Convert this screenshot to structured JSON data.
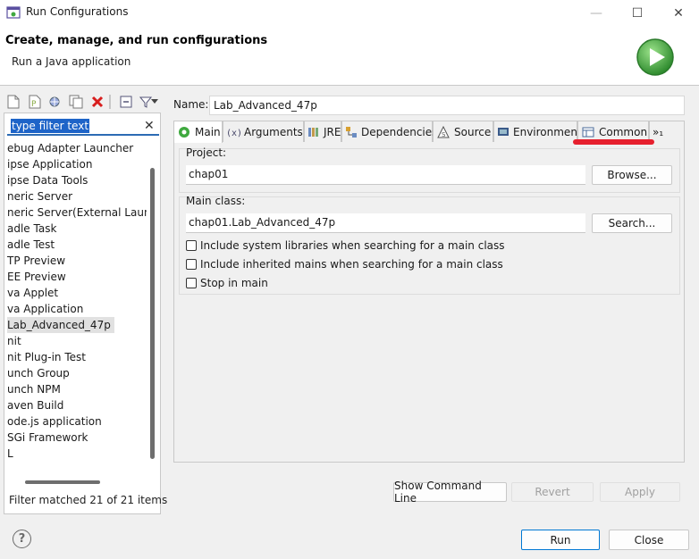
{
  "window": {
    "title": "Run Configurations",
    "min_glyph": "—",
    "max_glyph": "☐",
    "close_glyph": "✕"
  },
  "header": {
    "title": "Create, manage, and run configurations",
    "subtitle": "Run a Java application",
    "icon": "run-play-icon",
    "accent": "#3fa93f"
  },
  "left": {
    "toolbar_icons": [
      "new-config-icon",
      "new-prototype-icon",
      "export-icon",
      "duplicate-icon",
      "delete-icon",
      "collapse-all-icon",
      "filter-icon",
      "dropdown-arrow-icon"
    ],
    "filter_placeholder": "type filter text",
    "filter_clear_glyph": "✕",
    "items": [
      {
        "label": "ebug Adapter Launcher",
        "selected": false
      },
      {
        "label": "ipse Application",
        "selected": false
      },
      {
        "label": "ipse Data Tools",
        "selected": false
      },
      {
        "label": "neric Server",
        "selected": false
      },
      {
        "label": "neric Server(External Launch",
        "selected": false
      },
      {
        "label": "adle Task",
        "selected": false
      },
      {
        "label": "adle Test",
        "selected": false
      },
      {
        "label": "TP Preview",
        "selected": false
      },
      {
        "label": "EE Preview",
        "selected": false
      },
      {
        "label": "va Applet",
        "selected": false
      },
      {
        "label": "va Application",
        "selected": false
      },
      {
        "label": "Lab_Advanced_47p",
        "selected": true
      },
      {
        "label": "nit",
        "selected": false
      },
      {
        "label": "nit Plug-in Test",
        "selected": false
      },
      {
        "label": "unch Group",
        "selected": false
      },
      {
        "label": "unch NPM",
        "selected": false
      },
      {
        "label": "aven Build",
        "selected": false
      },
      {
        "label": "ode.js application",
        "selected": false
      },
      {
        "label": "SGi Framework",
        "selected": false
      },
      {
        "label": "L",
        "selected": false
      }
    ],
    "filter_status": "Filter matched 21 of 21 items"
  },
  "right": {
    "name_label": "Name:",
    "name_value": "Lab_Advanced_47p",
    "tabs": [
      {
        "label": "Main",
        "icon": "main-tab-icon",
        "active": true
      },
      {
        "label": "Arguments",
        "icon": "arguments-icon",
        "active": false
      },
      {
        "label": "JRE",
        "icon": "jre-icon",
        "active": false
      },
      {
        "label": "Dependencies",
        "icon": "dependencies-icon",
        "active": false
      },
      {
        "label": "Source",
        "icon": "source-icon",
        "active": false
      },
      {
        "label": "Environment",
        "icon": "environment-icon",
        "active": false
      },
      {
        "label": "Common",
        "icon": "common-icon",
        "active": false
      }
    ],
    "tab_overflow_label": "»₁",
    "project_label": "Project:",
    "project_value": "chap01",
    "browse_label": "Browse...",
    "main_class_label": "Main class:",
    "main_class_value": "chap01.Lab_Advanced_47p",
    "search_label": "Search...",
    "checks": [
      {
        "label": "Include system libraries when searching for a main class",
        "checked": false
      },
      {
        "label": "Include inherited mains when searching for a main class",
        "checked": false
      },
      {
        "label": "Stop in main",
        "checked": false
      }
    ],
    "show_command_line_label": "Show Command Line",
    "revert_label": "Revert",
    "apply_label": "Apply"
  },
  "footer": {
    "help_glyph": "?",
    "run_label": "Run",
    "close_label": "Close"
  },
  "colors": {
    "highlight_red": "#e6202e",
    "selection_blue": "#1e64c8",
    "primary_border": "#0078d4"
  }
}
